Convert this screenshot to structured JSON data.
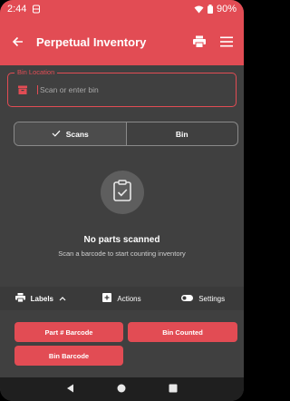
{
  "colors": {
    "accent": "#e24c54",
    "background": "#404040",
    "toolbar": "#3a3a3a",
    "nav": "#1f1f1f"
  },
  "status_bar": {
    "time": "2:44",
    "battery": "90%",
    "icons": [
      "data-saver-icon",
      "wifi-icon",
      "battery-icon"
    ]
  },
  "app_bar": {
    "title": "Perpetual Inventory",
    "icons": [
      "back-arrow-icon",
      "printer-icon",
      "menu-icon"
    ]
  },
  "bin_field": {
    "label": "Bin Location",
    "placeholder": "Scan or enter bin",
    "value": "",
    "icon": "bin-icon"
  },
  "segments": [
    {
      "label": "Scans",
      "selected": true,
      "icon": "check-icon"
    },
    {
      "label": "Bin",
      "selected": false
    }
  ],
  "empty_state": {
    "icon": "clipboard-check-icon",
    "title": "No parts scanned",
    "subtitle": "Scan a barcode to start counting inventory"
  },
  "toolbar": {
    "labels": "Labels",
    "actions": "Actions",
    "settings": "Settings"
  },
  "label_buttons": [
    "Part # Barcode",
    "Bin Counted",
    "Bin Barcode"
  ],
  "nav_bar": {
    "icons": [
      "back-triangle-icon",
      "home-circle-icon",
      "recents-square-icon"
    ]
  }
}
